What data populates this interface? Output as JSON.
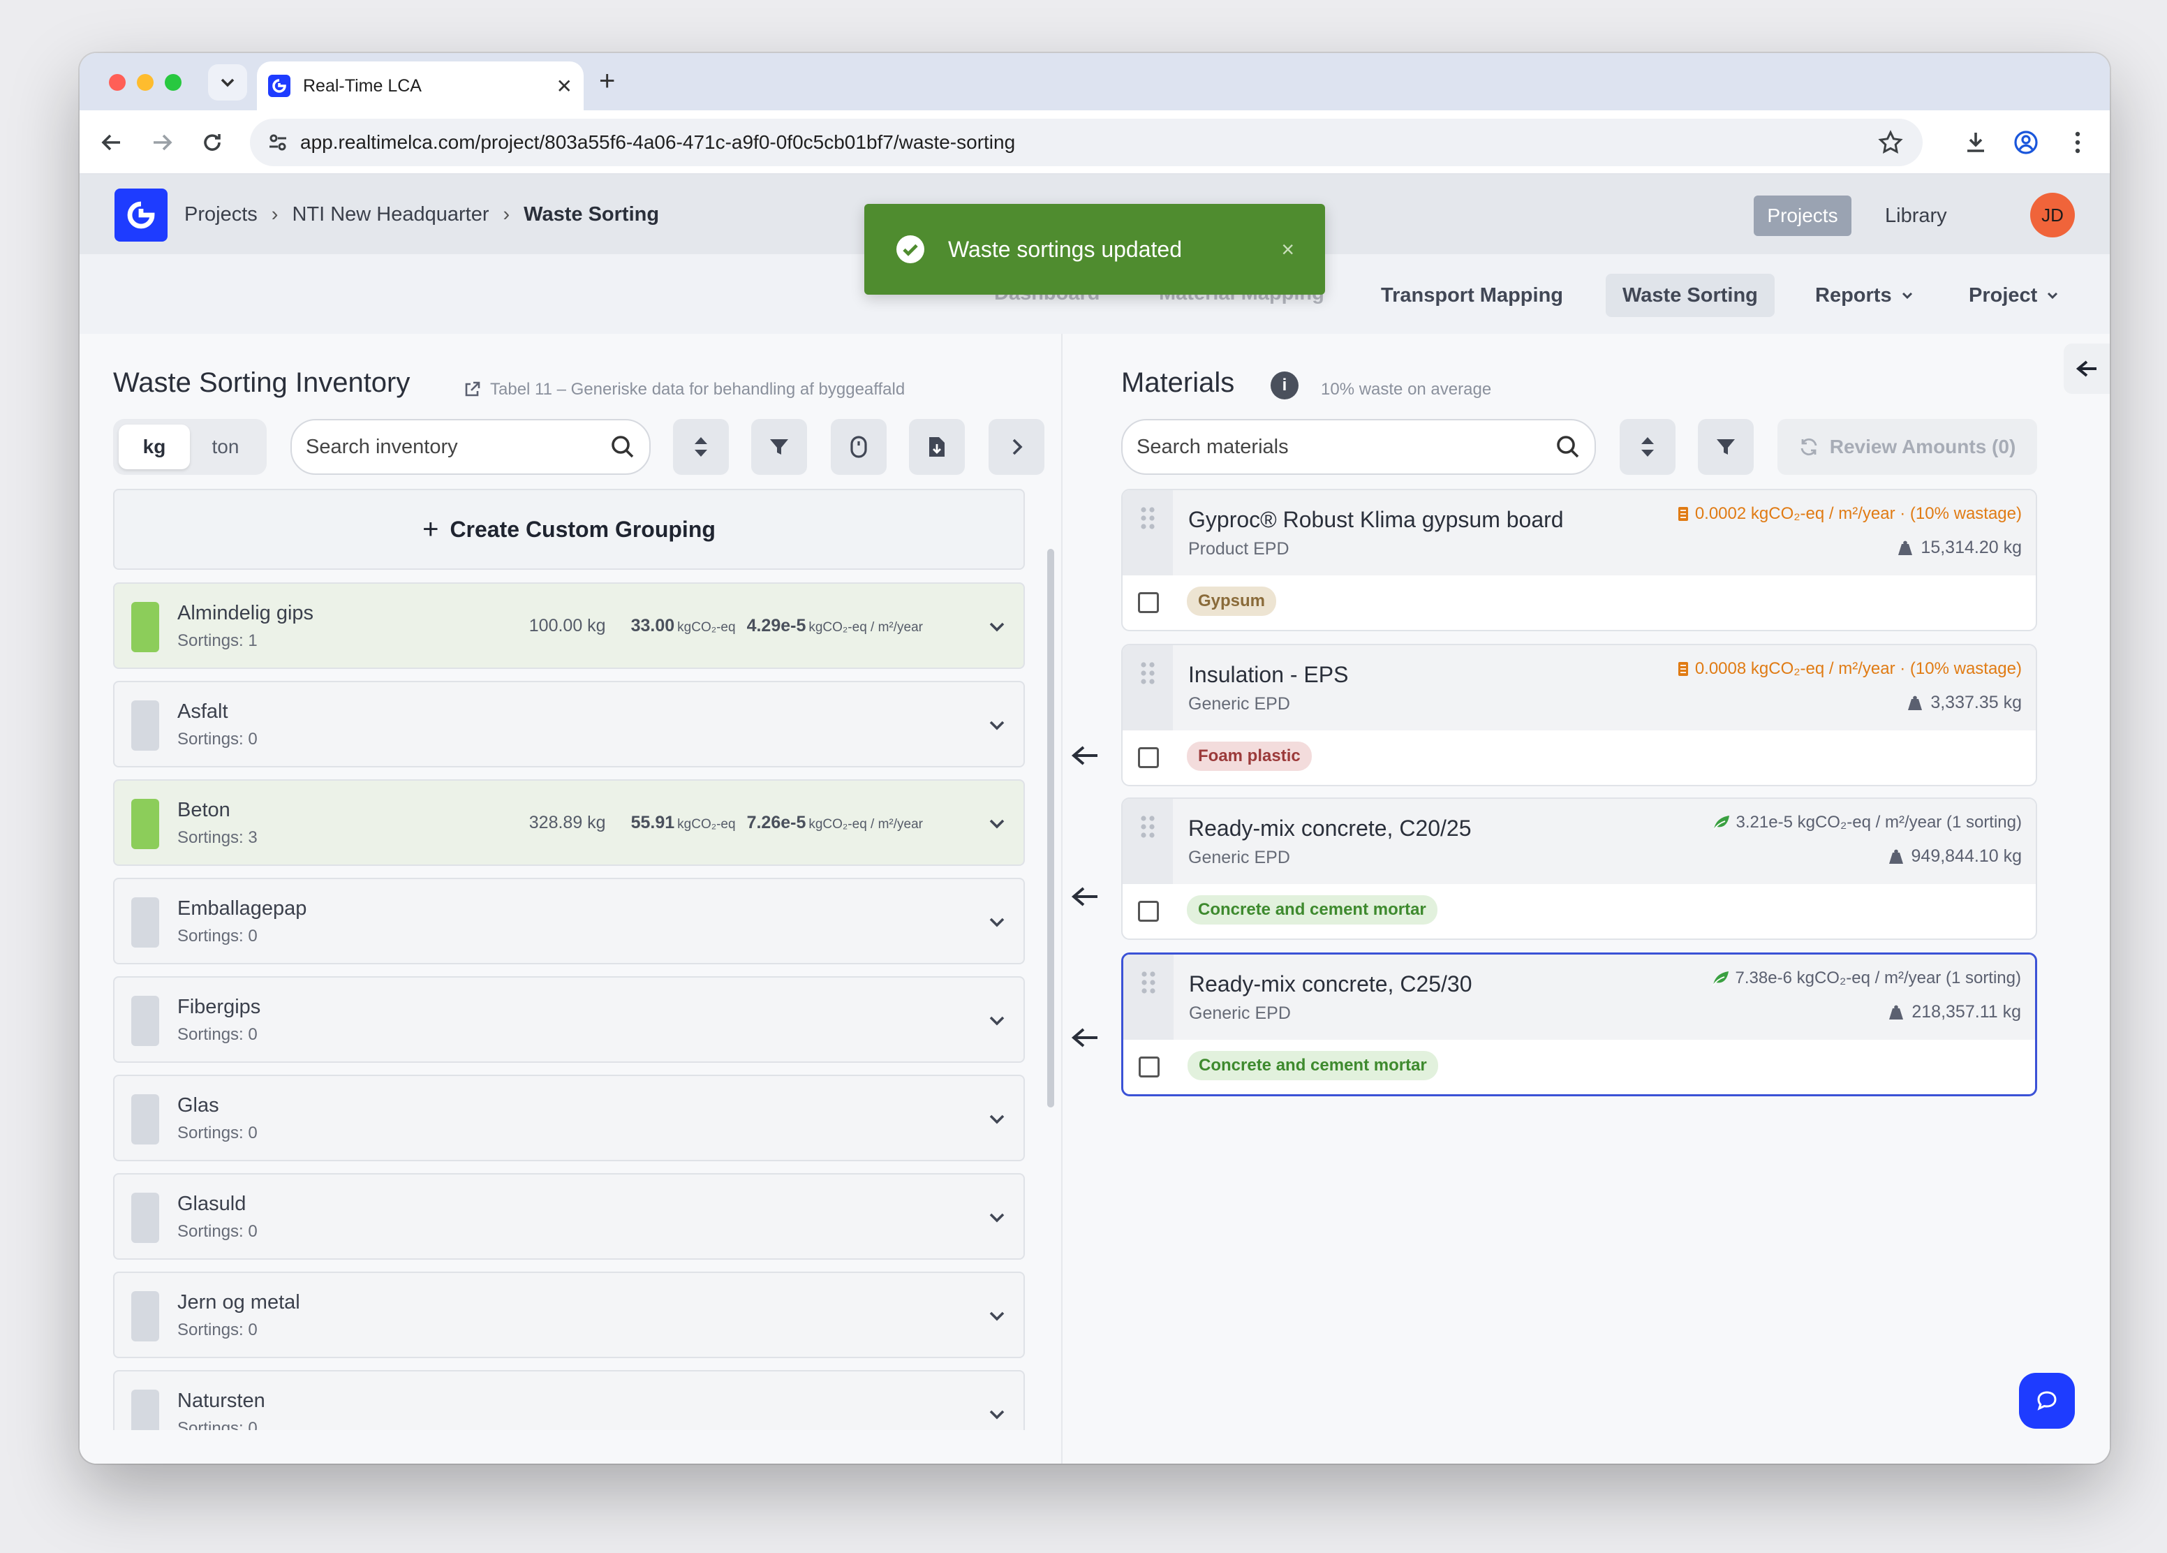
{
  "browser": {
    "tab_title": "Real-Time LCA",
    "new_tab": "+",
    "url": "app.realtimelca.com/project/803a55f6-4a06-471c-a9f0-0f0c5cb01bf7/waste-sorting"
  },
  "header": {
    "breadcrumbs": [
      "Projects",
      "NTI New Headquarter",
      "Waste Sorting"
    ],
    "projects_label": "Projects",
    "library_label": "Library",
    "avatar_initials": "JD"
  },
  "subnav": {
    "ghost_1": "Dashboard",
    "ghost_2": "Material Mapping",
    "transport": "Transport Mapping",
    "waste": "Waste Sorting",
    "reports": "Reports",
    "project": "Project"
  },
  "toast": {
    "message": "Waste sortings updated",
    "close": "×"
  },
  "inventory": {
    "title": "Waste Sorting Inventory",
    "link": "Tabel 11 – Generiske data for behandling af byggeaffald",
    "unit_kg": "kg",
    "unit_ton": "ton",
    "search_placeholder": "Search inventory",
    "create_label": "Create Custom Grouping",
    "items": [
      {
        "name": "Almindelig gips",
        "sortings": "Sortings: 1",
        "filled": true,
        "kg": "100.00 kg",
        "co2": "33.00",
        "co2_unit": "kgCO₂-eq",
        "rate": "4.29e-5",
        "rate_unit": "kgCO₂-eq / m²/year"
      },
      {
        "name": "Asfalt",
        "sortings": "Sortings: 0",
        "filled": false
      },
      {
        "name": "Beton",
        "sortings": "Sortings: 3",
        "filled": true,
        "kg": "328.89 kg",
        "co2": "55.91",
        "co2_unit": "kgCO₂-eq",
        "rate": "7.26e-5",
        "rate_unit": "kgCO₂-eq / m²/year"
      },
      {
        "name": "Emballagepap",
        "sortings": "Sortings: 0",
        "filled": false
      },
      {
        "name": "Fibergips",
        "sortings": "Sortings: 0",
        "filled": false
      },
      {
        "name": "Glas",
        "sortings": "Sortings: 0",
        "filled": false
      },
      {
        "name": "Glasuld",
        "sortings": "Sortings: 0",
        "filled": false
      },
      {
        "name": "Jern og metal",
        "sortings": "Sortings: 0",
        "filled": false
      },
      {
        "name": "Natursten",
        "sortings": "Sortings: 0",
        "filled": false
      }
    ]
  },
  "materials": {
    "title": "Materials",
    "info": "i",
    "subtitle": "10% waste on average",
    "search_placeholder": "Search materials",
    "review_label": "Review Amounts (0)",
    "cards": [
      {
        "title": "Gyproc® Robust Klima gypsum board",
        "type": "Product EPD",
        "co2": "0.0002 kgCO₂-eq / m²/year · (10% wastage)",
        "weight": "15,314.20 kg",
        "tag": "Gypsum",
        "tag_class": "gyp",
        "co2_color": "orange",
        "selected": false
      },
      {
        "title": "Insulation - EPS",
        "type": "Generic EPD",
        "co2": "0.0008 kgCO₂-eq / m²/year · (10% wastage)",
        "weight": "3,337.35 kg",
        "tag": "Foam plastic",
        "tag_class": "foam",
        "co2_color": "orange",
        "selected": false
      },
      {
        "title": "Ready-mix concrete, C20/25",
        "type": "Generic EPD",
        "co2": "3.21e-5 kgCO₂-eq / m²/year (1 sorting)",
        "weight": "949,844.10 kg",
        "tag": "Concrete and cement mortar",
        "tag_class": "conc",
        "co2_color": "green",
        "selected": false
      },
      {
        "title": "Ready-mix concrete, C25/30",
        "type": "Generic EPD",
        "co2": "7.38e-6 kgCO₂-eq / m²/year (1 sorting)",
        "weight": "218,357.11 kg",
        "tag": "Concrete and cement mortar",
        "tag_class": "conc",
        "co2_color": "green",
        "selected": true
      }
    ]
  },
  "colors": {
    "brand": "#1e3cff",
    "toast": "#4f8c2f",
    "filled_swatch": "#8ccd5a",
    "wastage": "#e07b14"
  }
}
